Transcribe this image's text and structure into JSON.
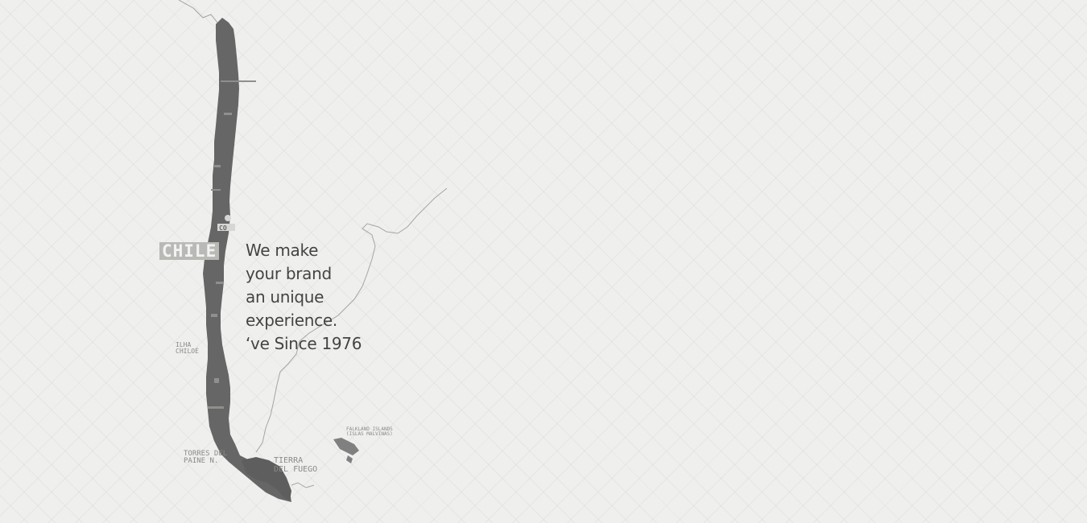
{
  "map": {
    "country_label": "CHILE",
    "region_labels": {
      "chiloe": [
        "ILHA",
        "CHILOÉ"
      ],
      "torres": [
        "TORRES DEL",
        "PAINE N."
      ],
      "tierra": [
        "TIERRA",
        "DEL FUEGO"
      ],
      "falkland": [
        "FALKLAND ISLANDS",
        "(ISLAS MALVINAS)"
      ]
    },
    "colors": {
      "land": "#666666",
      "border": "#9a9a98",
      "background": "#eff0ee"
    }
  },
  "tagline": {
    "line1": "We make",
    "line2": "your brand",
    "line3": "an unique",
    "line4": "experience.",
    "line5": "‘ve Since 1976"
  }
}
